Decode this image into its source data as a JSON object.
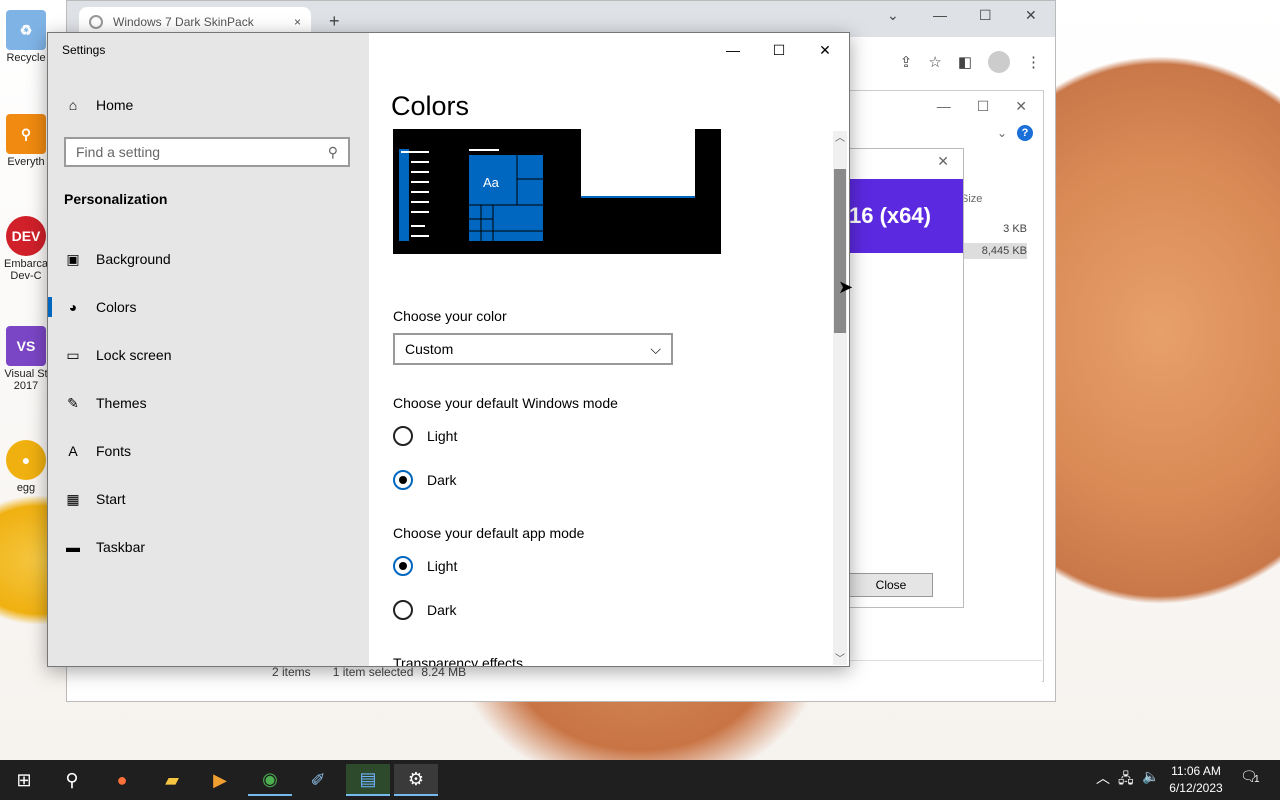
{
  "desktop": {
    "icons": [
      {
        "label": "Recycle",
        "color": "#7fb3e6",
        "glyph": "♻"
      },
      {
        "label": "Everyth",
        "color": "#f08a10",
        "glyph": "⚲"
      },
      {
        "label": "Embarca Dev-C",
        "color": "#d0202a",
        "glyph": "DEV"
      },
      {
        "label": "Visual St 2017",
        "color": "#7b46c6",
        "glyph": "VS"
      },
      {
        "label": "egg",
        "color": "#f0b010",
        "glyph": "●"
      }
    ]
  },
  "chrome": {
    "tab_title": "Windows 7 Dark SkinPack",
    "tab_close": "×",
    "new_tab": "+",
    "controls": [
      "⌄",
      "—",
      "☐",
      "✕"
    ]
  },
  "explorer": {
    "column_size": "Size",
    "values": [
      "3 KB",
      "8,445 KB"
    ],
    "status": {
      "items": "2 items",
      "selected": "1 item selected",
      "size": "8.24 MB"
    }
  },
  "installer": {
    "banner": "16 (x64)",
    "close_label": "Close"
  },
  "settings": {
    "window_title": "Settings",
    "home_label": "Home",
    "search_placeholder": "Find a setting",
    "section_label": "Personalization",
    "nav": [
      {
        "label": "Background",
        "icon": "🖼"
      },
      {
        "label": "Colors",
        "icon": "🎨"
      },
      {
        "label": "Lock screen",
        "icon": "🖥"
      },
      {
        "label": "Themes",
        "icon": "✎"
      },
      {
        "label": "Fonts",
        "icon": "A"
      },
      {
        "label": "Start",
        "icon": "▦"
      },
      {
        "label": "Taskbar",
        "icon": "▭"
      }
    ],
    "active_nav": "Colors",
    "page_title": "Colors",
    "preview_tile_label": "Aa",
    "choose_color_label": "Choose your color",
    "color_value": "Custom",
    "windows_mode_label": "Choose your default Windows mode",
    "windows_mode_options": [
      "Light",
      "Dark"
    ],
    "windows_mode_selected": "Dark",
    "app_mode_label": "Choose your default app mode",
    "app_mode_options": [
      "Light",
      "Dark"
    ],
    "app_mode_selected": "Light",
    "transparency_label": "Transparency effects",
    "accent_color": "#0067c0"
  },
  "taskbar": {
    "clock_time": "11:06 AM",
    "clock_date": "6/12/2023",
    "notification_count": "1"
  }
}
